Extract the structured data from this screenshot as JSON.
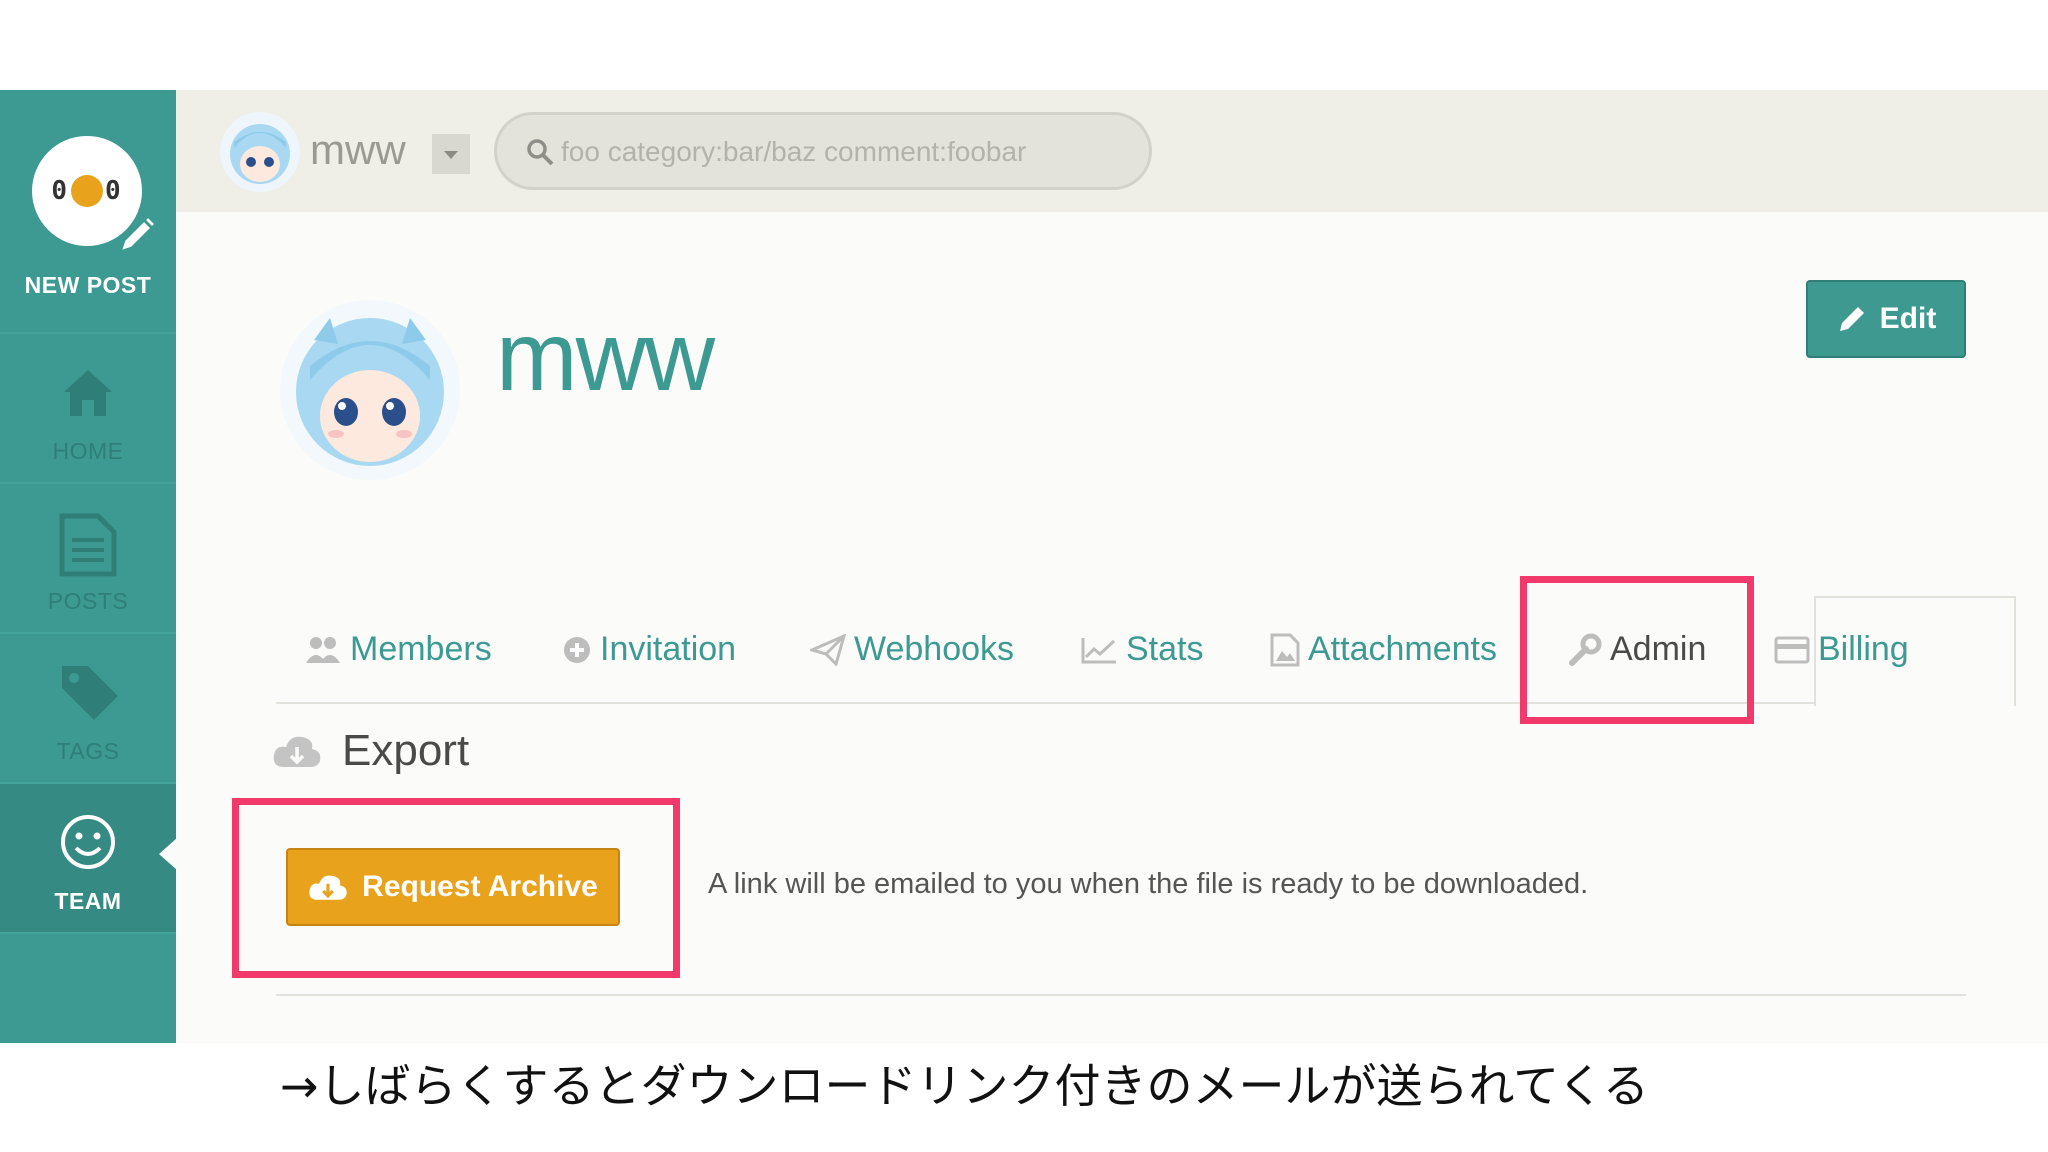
{
  "sidebar": {
    "logo_text": "0",
    "logo_text_right": "0",
    "new_post_label": "NEW POST",
    "items": [
      {
        "label": "HOME",
        "icon": "home-icon"
      },
      {
        "label": "POSTS",
        "icon": "document-icon"
      },
      {
        "label": "TAGS",
        "icon": "tag-icon"
      },
      {
        "label": "TEAM",
        "icon": "smiley-icon",
        "active": true
      }
    ]
  },
  "topbar": {
    "team_name": "mww",
    "search_placeholder": "foo category:bar/baz comment:foobar"
  },
  "team": {
    "name": "mww",
    "edit_label": "Edit"
  },
  "tabs": [
    {
      "label": "Members",
      "icon": "members-icon"
    },
    {
      "label": "Invitation",
      "icon": "plus-circle-icon"
    },
    {
      "label": "Webhooks",
      "icon": "paper-plane-icon"
    },
    {
      "label": "Stats",
      "icon": "line-chart-icon"
    },
    {
      "label": "Attachments",
      "icon": "image-file-icon"
    },
    {
      "label": "Admin",
      "icon": "wrench-icon",
      "active": true
    },
    {
      "label": "Billing",
      "icon": "credit-card-icon"
    }
  ],
  "export": {
    "heading": "Export",
    "button_label": "Request Archive",
    "description": "A link will be emailed to you when the file is ready to be downloaded."
  },
  "annotation": {
    "highlight_color": "#f2396c",
    "footnote": "→しばらくするとダウンロードリンク付きのメールが送られてくる"
  },
  "colors": {
    "brand_teal": "#3c9a93",
    "archive_orange": "#e9a21b"
  }
}
